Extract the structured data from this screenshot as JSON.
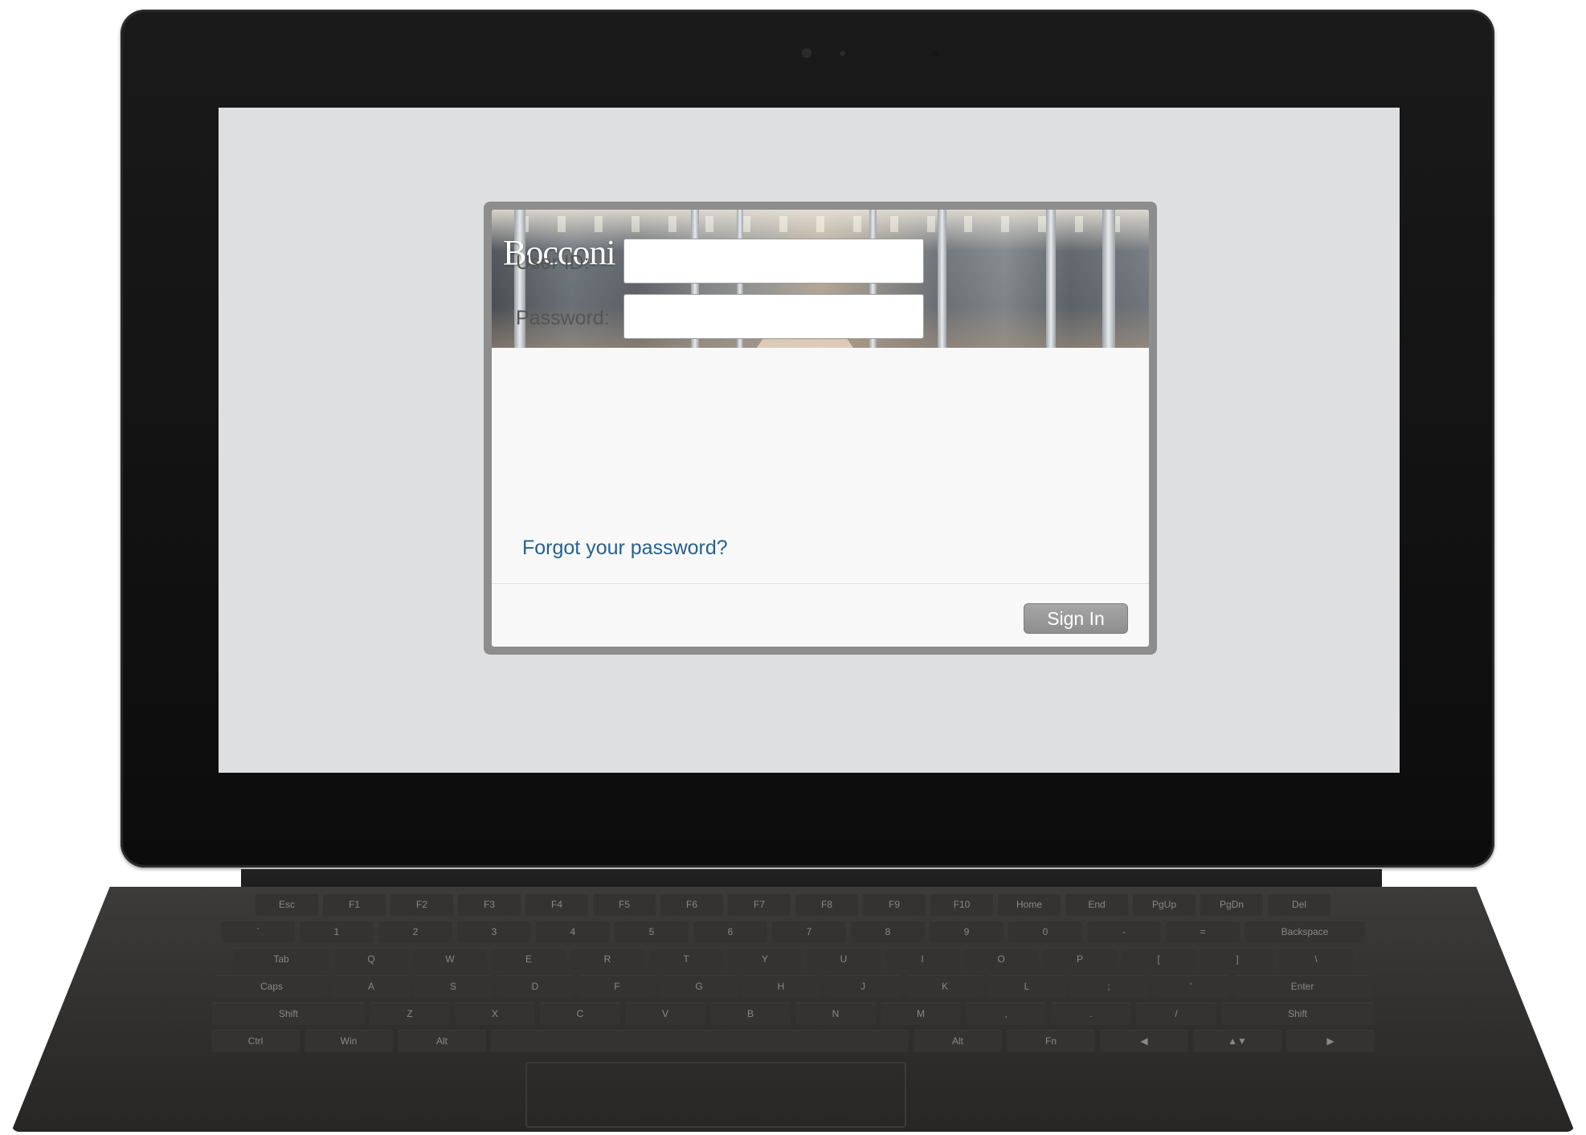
{
  "login": {
    "banner_logo": "Bocconi",
    "user_id_label": "User ID:",
    "user_id_value": "",
    "password_label": "Password:",
    "password_value": "",
    "forgot_link": "Forgot your password?",
    "sign_in_label": "Sign In"
  },
  "keyboard": {
    "row1": [
      "Esc",
      "F1",
      "F2",
      "F3",
      "F4",
      "F5",
      "F6",
      "F7",
      "F8",
      "F9",
      "F10",
      "Home",
      "End",
      "PgUp",
      "PgDn",
      "Del"
    ],
    "row2": [
      "`",
      "1",
      "2",
      "3",
      "4",
      "5",
      "6",
      "7",
      "8",
      "9",
      "0",
      "-",
      "=",
      "Backspace"
    ],
    "row3": [
      "Tab",
      "Q",
      "W",
      "E",
      "R",
      "T",
      "Y",
      "U",
      "I",
      "O",
      "P",
      "[",
      "]",
      "\\"
    ],
    "row4": [
      "Caps",
      "A",
      "S",
      "D",
      "F",
      "G",
      "H",
      "J",
      "K",
      "L",
      ";",
      "'",
      "Enter"
    ],
    "row5": [
      "Shift",
      "Z",
      "X",
      "C",
      "V",
      "B",
      "N",
      "M",
      ",",
      ".",
      "/",
      "Shift"
    ],
    "row6": [
      "Ctrl",
      "Win",
      "Alt",
      "",
      "Alt",
      "Fn",
      "◀",
      "▲▼",
      "▶"
    ]
  },
  "colors": {
    "screen_bg": "#dedfe0",
    "dialog_frame": "#8d8d8d",
    "link": "#24628f",
    "button": "#9a9a9a"
  }
}
